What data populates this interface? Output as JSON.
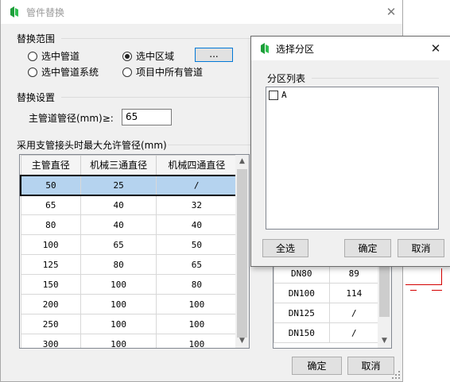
{
  "main_window": {
    "title": "管件替换",
    "close_glyph": "✕",
    "replace_scope": {
      "title": "替换范围",
      "options": [
        {
          "label": "选中管道",
          "checked": false
        },
        {
          "label": "选中区域",
          "checked": true
        },
        {
          "label": "选中管道系统",
          "checked": false
        },
        {
          "label": "项目中所有管道",
          "checked": false
        }
      ],
      "browse_label": "..."
    },
    "replace_settings": {
      "title": "替换设置",
      "main_pipe_label": "主管道管径(mm)≥:",
      "main_pipe_value": "65"
    },
    "branch_group": {
      "title": "采用支管接头时最大允许管径(mm)",
      "columns": [
        "主管直径",
        "机械三通直径",
        "机械四通直径"
      ],
      "rows": [
        [
          "50",
          "25",
          "/"
        ],
        [
          "65",
          "40",
          "32"
        ],
        [
          "80",
          "40",
          "40"
        ],
        [
          "100",
          "65",
          "50"
        ],
        [
          "125",
          "80",
          "65"
        ],
        [
          "150",
          "100",
          "80"
        ],
        [
          "200",
          "100",
          "100"
        ],
        [
          "250",
          "100",
          "100"
        ],
        [
          "300",
          "100",
          "100"
        ]
      ],
      "selected_row": 0
    },
    "second_table": {
      "rows": [
        [
          "DN80",
          "89"
        ],
        [
          "DN100",
          "114"
        ],
        [
          "DN125",
          "/"
        ],
        [
          "DN150",
          "/"
        ]
      ]
    },
    "ok_label": "确定",
    "cancel_label": "取消"
  },
  "zone_dialog": {
    "title": "选择分区",
    "close_glyph": "✕",
    "list_title": "分区列表",
    "zones": [
      {
        "label": "A",
        "checked": false
      }
    ],
    "select_all_label": "全选",
    "ok_label": "确定",
    "cancel_label": "取消"
  },
  "colors": {
    "selected_row": "#b5d3ef",
    "background_lines": "#d40000",
    "app_icon": "#1e9e3a"
  },
  "icons": {
    "app": "app-icon",
    "close": "close-icon",
    "scroll_up": "scroll-up-arrow-icon",
    "scroll_down": "scroll-down-arrow-icon",
    "resize": "resize-grip-icon"
  }
}
